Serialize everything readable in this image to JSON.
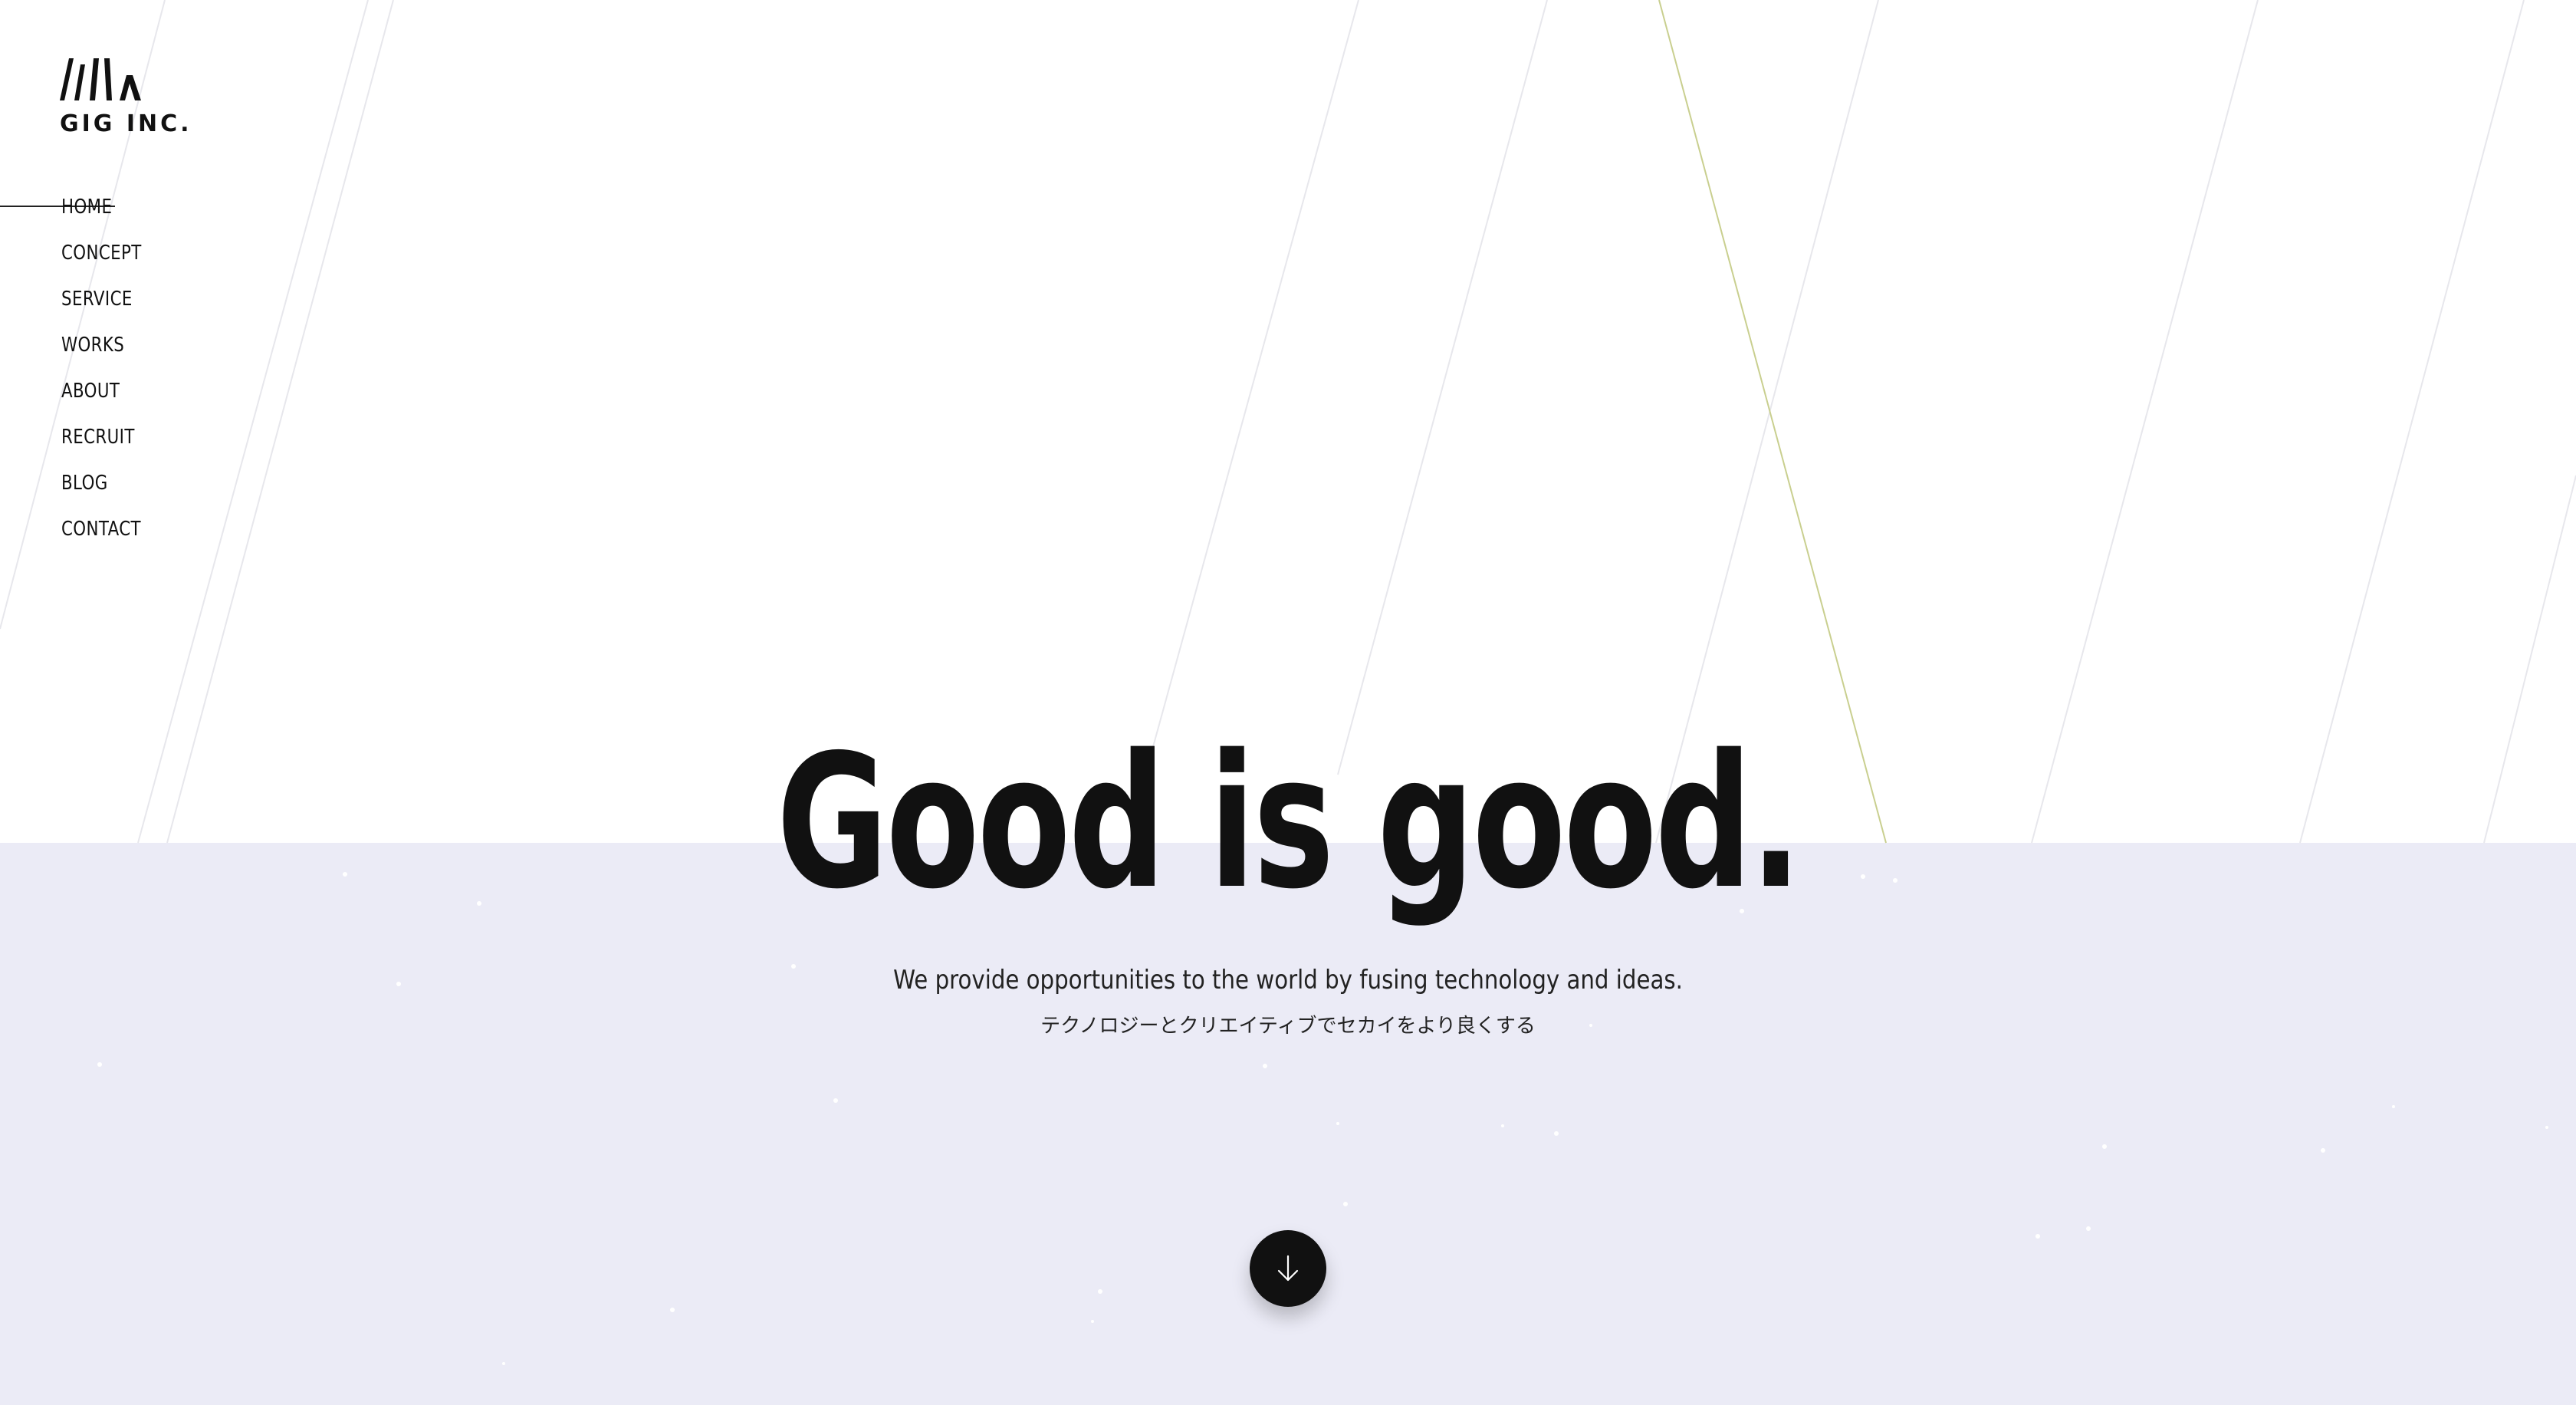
{
  "logo": {
    "text": "GIG INC."
  },
  "nav": {
    "items": [
      {
        "label": "HOME",
        "active": true
      },
      {
        "label": "CONCEPT"
      },
      {
        "label": "SERVICE"
      },
      {
        "label": "WORKS"
      },
      {
        "label": "ABOUT"
      },
      {
        "label": "RECRUIT"
      },
      {
        "label": "BLOG"
      },
      {
        "label": "CONTACT"
      }
    ]
  },
  "hero": {
    "headline": "Good is good.",
    "tagline_en": "We provide opportunities to the world by fusing technology and ideas.",
    "tagline_ja": "テクノロジーとクリエイティブでセカイをより良くする"
  },
  "scroll_button": {
    "icon": "arrow-down-icon"
  },
  "colors": {
    "text": "#111111",
    "band": "#ebebf6",
    "accent_line": "#c9cf8f",
    "button": "#111111"
  }
}
